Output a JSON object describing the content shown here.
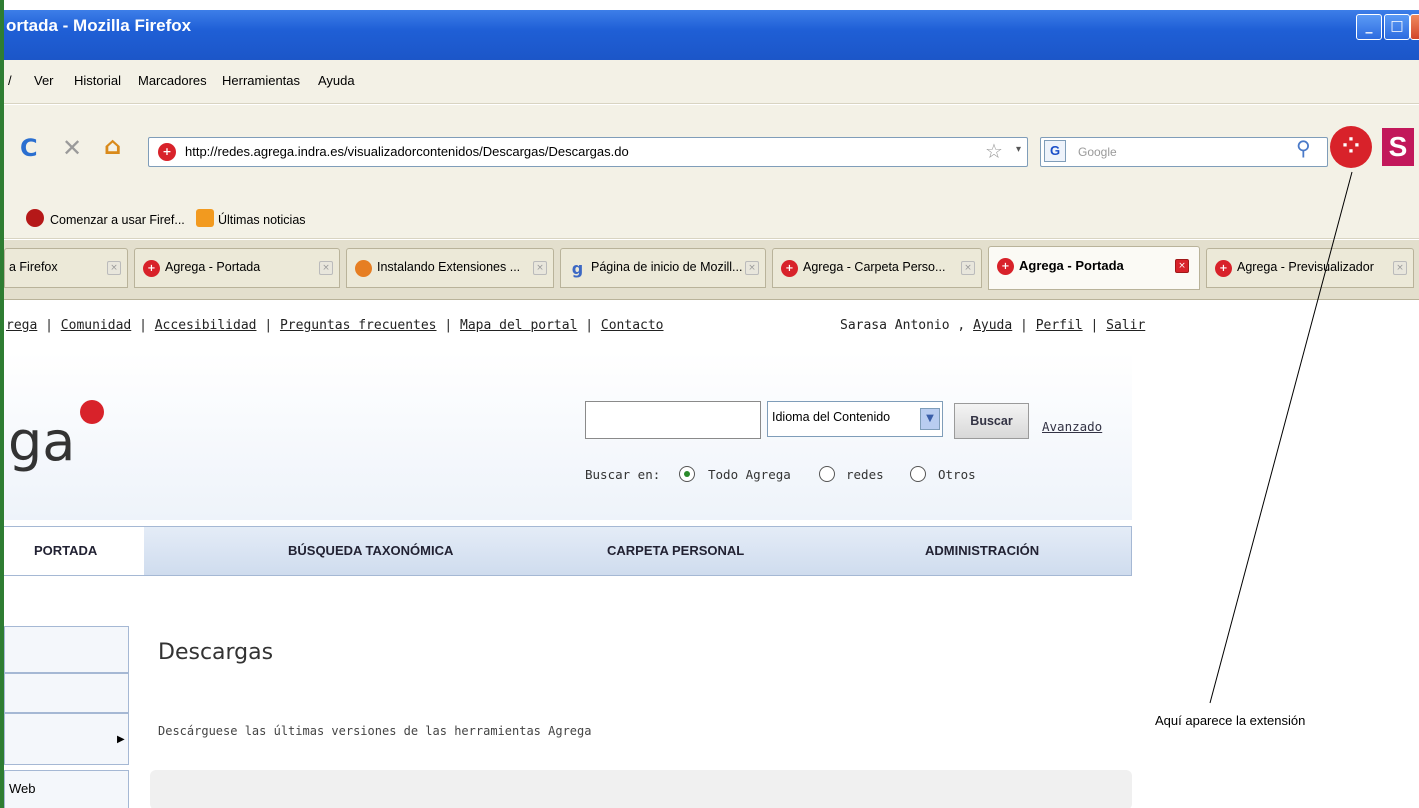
{
  "window": {
    "title": "ortada - Mozilla Firefox"
  },
  "menu": {
    "items": [
      "Ver",
      "Historial",
      "Marcadores",
      "Herramientas",
      "Ayuda"
    ],
    "leading": "/"
  },
  "nav": {
    "url": "http://redes.agrega.indra.es/visualizadorcontenidos/Descargas/Descargas.do",
    "search_placeholder": "Google",
    "ext_label": "S"
  },
  "bookmarks": {
    "items": [
      "Comenzar a usar Firef...",
      "Últimas noticias"
    ]
  },
  "tabs": [
    {
      "label": "a Firefox"
    },
    {
      "label": "Agrega - Portada"
    },
    {
      "label": "Instalando Extensiones ..."
    },
    {
      "label": "Página de inicio de Mozill..."
    },
    {
      "label": "Agrega - Carpeta Perso..."
    },
    {
      "label": "Agrega - Portada"
    },
    {
      "label": "Agrega - Previsualizador"
    }
  ],
  "toplinks": {
    "items": [
      "rega",
      "Comunidad",
      "Accesibilidad",
      "Preguntas frecuentes",
      "Mapa del portal",
      "Contacto"
    ],
    "user": "Sarasa Antonio ,",
    "right_links": [
      "Ayuda",
      "Perfil",
      "Salir"
    ]
  },
  "header": {
    "logo_text": "ga",
    "language_select": "Idioma del Contenido",
    "search_button": "Buscar",
    "advanced_link": "Avanzado",
    "search_in_label": "Buscar en:",
    "radios": [
      "Todo Agrega",
      "redes",
      "Otros"
    ]
  },
  "mainnav": [
    "PORTADA",
    "BÚSQUEDA TAXONÓMICA",
    "CARPETA PERSONAL",
    "ADMINISTRACIÓN"
  ],
  "sidebar": {
    "last_item": "Web"
  },
  "content": {
    "title": "Descargas",
    "subtitle": "Descárguese las últimas versiones de las herramientas Agrega"
  },
  "annotation": {
    "text": "Aquí aparece la extensión"
  }
}
